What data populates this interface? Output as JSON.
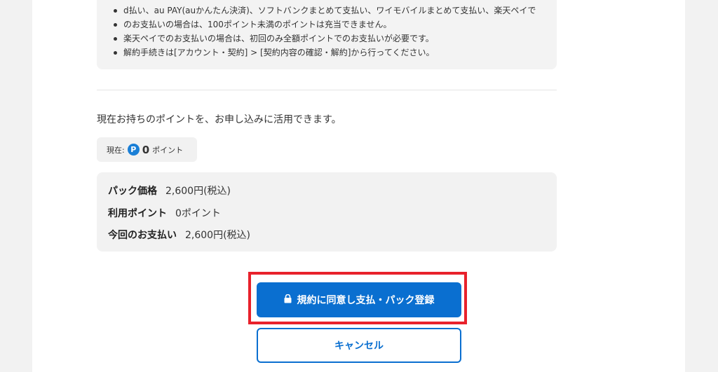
{
  "notes": [
    "d払い、au PAY(auかんたん決済)、ソフトバンクまとめて支払い、ワイモバイルまとめて支払い、楽天ペイで",
    "のお支払いの場合は、100ポイント未満のポイントは充当できません。",
    "楽天ペイでのお支払いの場合は、初回のみ全額ポイントでのお支払いが必要です。",
    "解約手続きは[アカウント・契約] > [契約内容の確認・解約]から行ってください。"
  ],
  "points": {
    "intro": "現在お持ちのポイントを、お申し込みに活用できます。",
    "current_label": "現在:",
    "icon_letter": "P",
    "current_value": "0",
    "unit": "ポイント"
  },
  "summary": {
    "price_label": "パック価格",
    "price_value": "2,600円(税込)",
    "used_label": "利用ポイント",
    "used_value": "0ポイント",
    "pay_label": "今回のお支払い",
    "pay_value": "2,600円(税込)"
  },
  "buttons": {
    "agree": "規約に同意し支払・パック登録",
    "cancel": "キャンセル"
  },
  "colors": {
    "primary": "#0a6fd0",
    "highlight": "#e8212b",
    "point_icon": "#1a7fd6"
  }
}
